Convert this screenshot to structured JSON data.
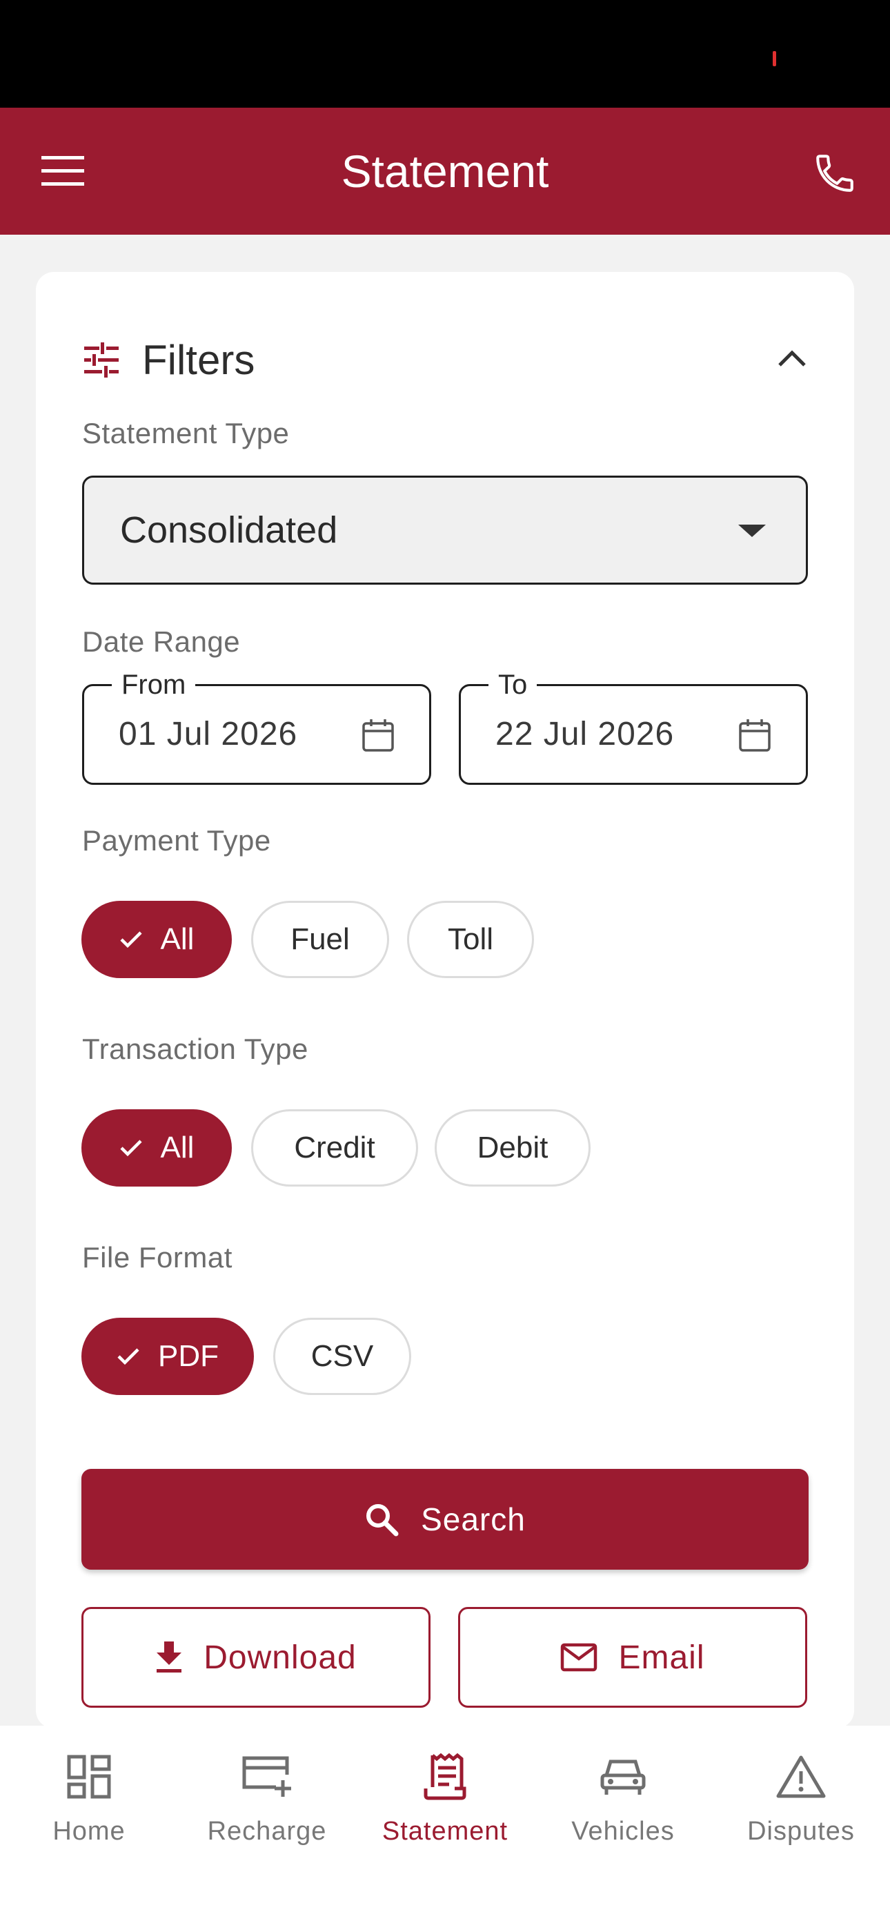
{
  "app_bar": {
    "title": "Statement"
  },
  "filters": {
    "title": "Filters",
    "statement_type": {
      "label": "Statement Type",
      "value": "Consolidated"
    },
    "date_range": {
      "label": "Date Range",
      "from": {
        "label": "From",
        "value": "01 Jul 2026"
      },
      "to": {
        "label": "To",
        "value": "22 Jul 2026"
      }
    },
    "payment_type": {
      "label": "Payment Type",
      "options": [
        "All",
        "Fuel",
        "Toll"
      ],
      "selected": "All"
    },
    "transaction_type": {
      "label": "Transaction Type",
      "options": [
        "All",
        "Credit",
        "Debit"
      ],
      "selected": "All"
    },
    "file_format": {
      "label": "File Format",
      "options": [
        "PDF",
        "CSV"
      ],
      "selected": "PDF"
    }
  },
  "actions": {
    "search": "Search",
    "download": "Download",
    "email": "Email"
  },
  "bottom_nav": {
    "items": [
      {
        "label": "Home",
        "icon": "dashboard-icon"
      },
      {
        "label": "Recharge",
        "icon": "card-add-icon"
      },
      {
        "label": "Statement",
        "icon": "receipt-icon"
      },
      {
        "label": "Vehicles",
        "icon": "car-icon"
      },
      {
        "label": "Disputes",
        "icon": "warning-icon"
      }
    ],
    "active": "Statement"
  },
  "colors": {
    "primary": "#9b1b30",
    "background": "#f2f2f2",
    "surface": "#ffffff",
    "status_bar": "#000000"
  }
}
